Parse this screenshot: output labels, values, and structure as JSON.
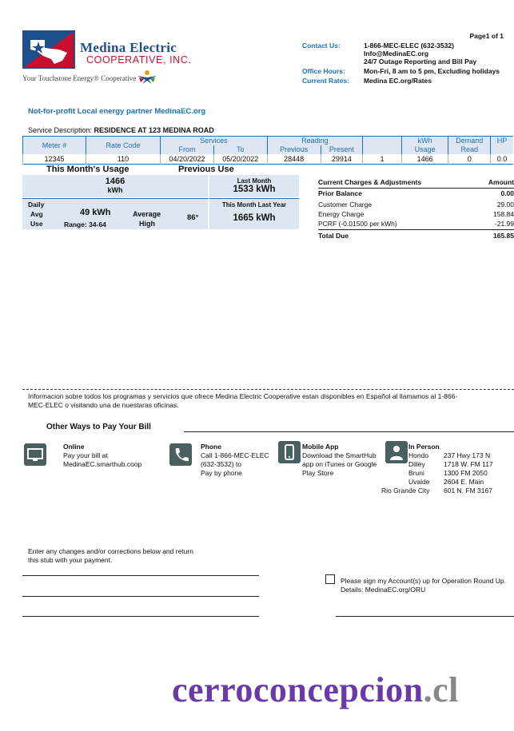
{
  "page_label": "Page1 of 1",
  "company": {
    "name": "Medina Electric",
    "sub": "COOPERATIVE, INC.",
    "tagline": "Your Touchstone Energy® Cooperative"
  },
  "contact": {
    "contact_label": "Contact Us:",
    "phone": "1-866-MEC-ELEC (632-3532)",
    "email": "Info@MedinaEC.org",
    "outage": "24/7 Outage Reporting and Bill Pay",
    "hours_label": "Office Hours:",
    "hours": "Mon-Fri, 8 am to 5 pm, Excluding holidays",
    "rates_label": "Current Rates:",
    "rates": "Medina EC.org/Rates"
  },
  "nonprofit_line": "Not-for-profit Local energy partner MedinaEC.org",
  "service": {
    "label": "Service Description:",
    "value": "RESIDENCE AT 123 MEDINA ROAD"
  },
  "meter_table": {
    "h_meter": "Meter #",
    "h_rate": "Rate Code",
    "h_services": "Services",
    "h_reading": "Reading",
    "h_kwh": "kWh",
    "h_demand": "Demand",
    "h_hp": "HP",
    "h_from": "From",
    "h_to": "To",
    "h_previous": "Previous",
    "h_present": "Present",
    "h_usage": "Usage",
    "h_read": "Read",
    "row": {
      "meter": "12345",
      "rate": "110",
      "from": "04/20/2022",
      "to": "05/20/2022",
      "previous": "28448",
      "present": "29914",
      "mult": "1",
      "usage": "1466",
      "demand": "0",
      "hp": "0.0"
    }
  },
  "usage": {
    "this_month_label": "This Month's Usage",
    "previous_label": "Previous Use",
    "this_month_value": "1466",
    "this_month_unit": "kWh",
    "last_month_label": "Last Month",
    "last_month_value": "1533 kWh",
    "daily_label_1": "Daily",
    "daily_label_2": "Avg",
    "daily_label_3": "Use",
    "daily_value": "49 kWh",
    "range": "Range: 34-64",
    "avg_high_1": "Average",
    "avg_high_2": "High",
    "temp": "86°",
    "last_year_label": "This Month Last Year",
    "last_year_value": "1665 kWh"
  },
  "charges": {
    "title": "Current Charges & Adjustments",
    "amount_label": "Amount",
    "rows": [
      {
        "label": "Prior Balance",
        "value": "0.00"
      },
      {
        "label": "Customer Charge",
        "value": "29.00"
      },
      {
        "label": "Energy Charge",
        "value": "158.84"
      },
      {
        "label": "PCRF (-0.01500 per kWh)",
        "value": "-21.99"
      }
    ],
    "total_label": "Total Due",
    "total_value": "165.85"
  },
  "spanish_notice": "Informacion sobre todos los programas y servicios que ofrece Medina Electric Cooperative estan disponibles en Español al llamamos al 1-866-MEC-ELEC o visitando una de nuestaras oficinas.",
  "pay": {
    "title": "Other Ways to Pay Your Bill",
    "online_title": "Online",
    "online_1": "Pay your bill at",
    "online_2": "MedinaEC.smarthub.coop",
    "phone_title": "Phone",
    "phone_1": "Call 1-866-MEC-ELEC",
    "phone_2": "(632-3532) to",
    "phone_3": "Pay by phone",
    "mobile_title": "Mobile App",
    "mobile_1": "Download the SmartHub",
    "mobile_2": "app on iTunes or Google",
    "mobile_3": "Play Store",
    "person_title": "In Person",
    "locations": [
      {
        "city": "Hondo",
        "addr": "237 Hwy 173 N"
      },
      {
        "city": "Dilley",
        "addr": "1718 W. FM 117"
      },
      {
        "city": "Bruni",
        "addr": "1300 FM 2050"
      },
      {
        "city": "Uvalde",
        "addr": "2604 E. Main"
      },
      {
        "city": "Rio Grande City",
        "addr": "601 N. FM 3167"
      }
    ]
  },
  "stub": {
    "instructions_1": "Enter any changes and/or corrections below and return",
    "instructions_2": "this stub with your payment.",
    "roundup_1": "Please sign my Account(s) up for Operation Round Up.",
    "roundup_2": "Details: MedinaEC.org/ORU"
  },
  "watermark": {
    "main": "cerroconcepcion",
    "tld": ".cl"
  },
  "colors": {
    "accent_blue": "#1f6fb5",
    "brand_navy": "#1c4f8c",
    "brand_red": "#c8102e",
    "panel_fill": "#dde6f2",
    "icon_fill": "#4a6060",
    "watermark_purple": "#6a3aa8"
  }
}
